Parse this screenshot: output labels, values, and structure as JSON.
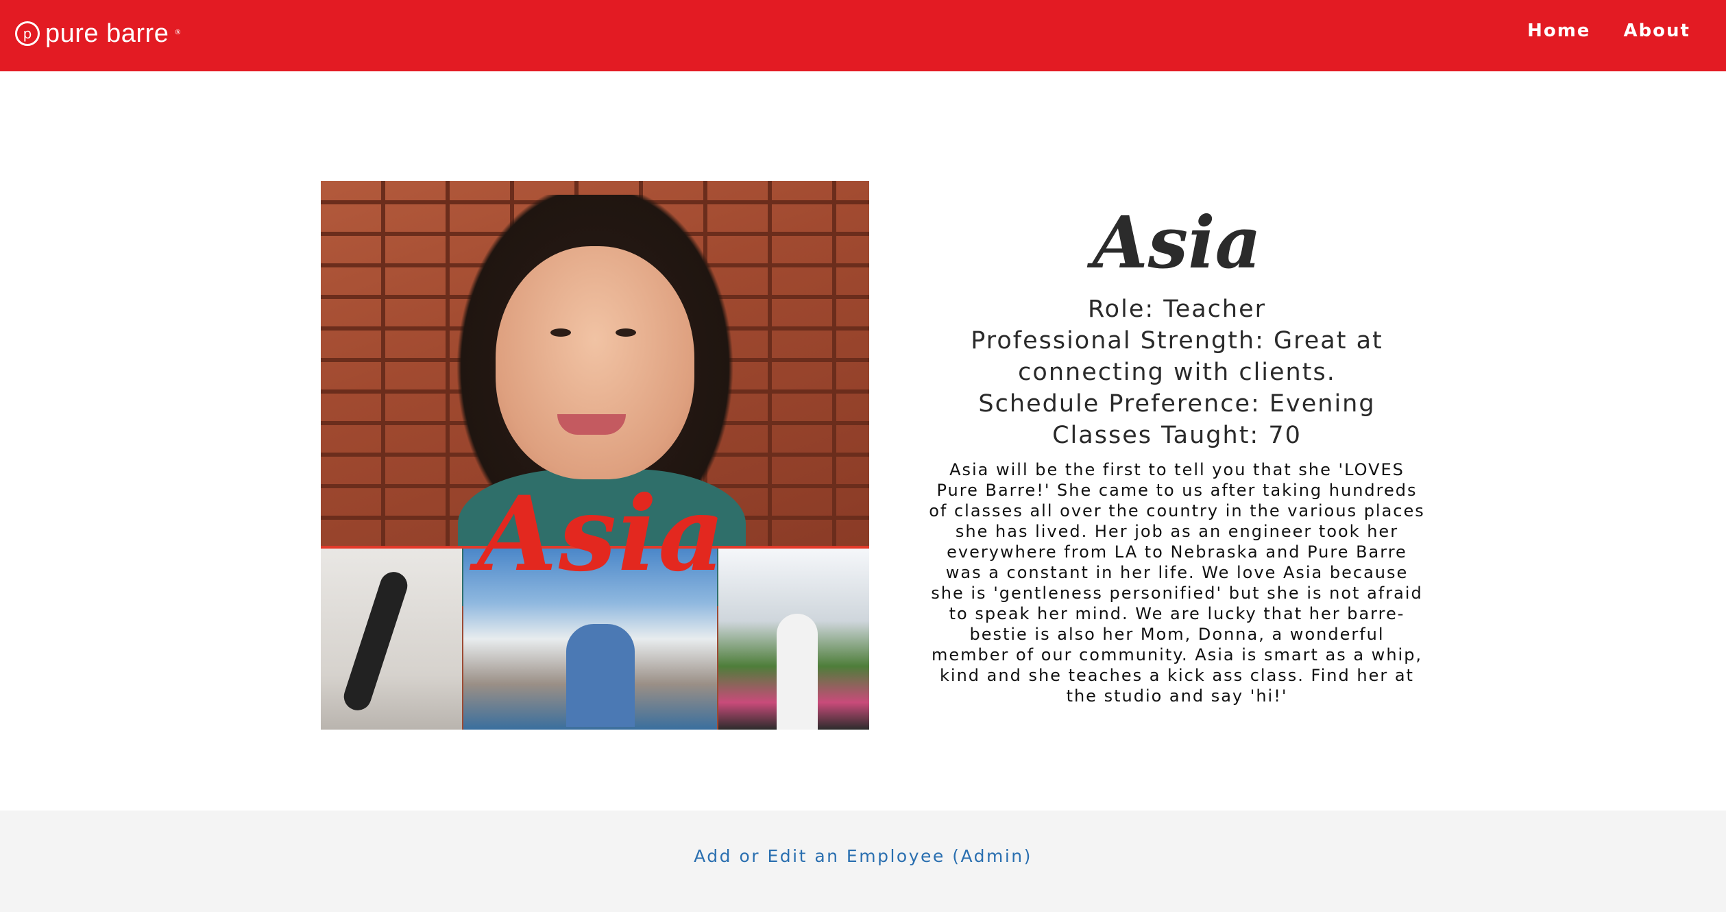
{
  "nav": {
    "brand": "pure barre",
    "brand_glyph": "p",
    "brand_reg": "®",
    "links": [
      "Home",
      "About"
    ]
  },
  "photo": {
    "overlay_text": "Asia"
  },
  "employee": {
    "name": "Asia",
    "role": "Role: Teacher",
    "strength": "Professional Strength: Great at connecting with clients.",
    "schedule": "Schedule Preference: Evening",
    "classes": "Classes Taught: 70",
    "bio": "Asia will be the first to tell you that she 'LOVES Pure Barre!' She came to us after taking hundreds of classes all over the country in the various places she has lived. Her job as an engineer took her everywhere from LA to Nebraska and Pure Barre was a constant in her life. We love Asia because she is 'gentleness personified' but she is not afraid to speak her mind. We are lucky that her barre-bestie is also her Mom, Donna, a wonderful member of our community. Asia is smart as a whip, kind and she teaches a kick ass class. Find her at the studio and say 'hi!'"
  },
  "footer": {
    "admin_link": "Add or Edit an Employee (Admin)"
  },
  "colors": {
    "nav_bg": "#e31b23",
    "footer_bg": "#f4f4f4",
    "link": "#2a6fb0"
  }
}
